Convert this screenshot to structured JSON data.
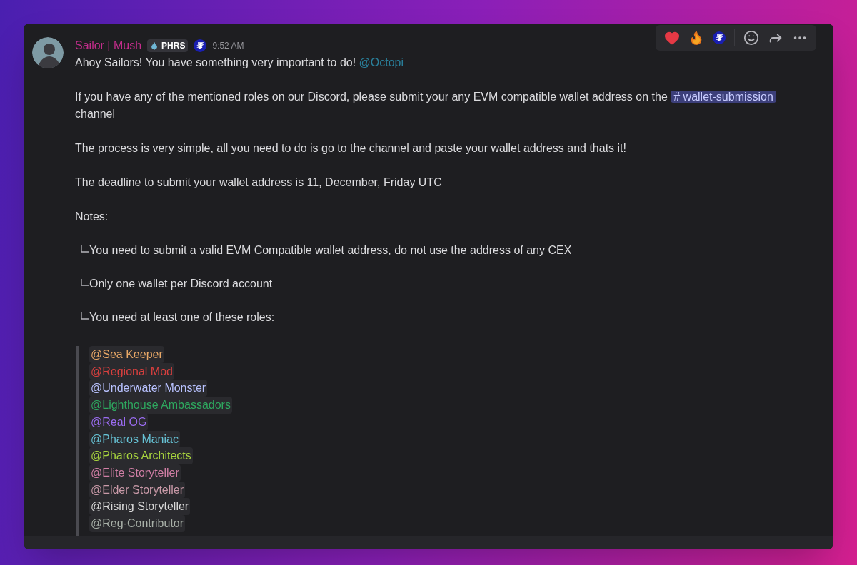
{
  "message": {
    "author": "Sailor | Mush",
    "tag": "PHRS",
    "time": "9:52 AM",
    "paragraphs": [
      {
        "kind": "text",
        "text": "Ahoy Sailors! You have something very important to do! ",
        "mention": "@Octopi"
      },
      {
        "kind": "text",
        "text": "If you have any of the mentioned roles on our Discord, please submit your any EVM compatible wallet address on the ",
        "channel": "wallet-submission",
        "channel_icon": "#",
        "after": " channel"
      },
      {
        "kind": "text",
        "text": "The process is very simple, all you need to do is go to the channel and paste your wallet address and thats it!"
      },
      {
        "kind": "text",
        "text": "The deadline to submit your wallet address is 11, December, Friday UTC"
      },
      {
        "kind": "text",
        "text": "Notes:"
      },
      {
        "kind": "bullet",
        "text": "You need to submit a valid EVM Compatible wallet address, do not use the address of any CEX"
      },
      {
        "kind": "bullet",
        "text": "Only one wallet per Discord account"
      },
      {
        "kind": "bullet",
        "text": "You need at least one of these roles:"
      }
    ],
    "roles": [
      {
        "text": "@Sea Keeper",
        "color": "#e8a867"
      },
      {
        "text": "@Regional Mod",
        "color": "#d9403f"
      },
      {
        "text": "@Underwater Monster",
        "color": "#b9c2ff"
      },
      {
        "text": "@Lighthouse Ambassadors",
        "color": "#2ea85f"
      },
      {
        "text": "@Real OG",
        "color": "#9b6cf2"
      },
      {
        "text": "@Pharos Maniac",
        "color": "#67c3d6"
      },
      {
        "text": "@Pharos Architects",
        "color": "#a8d43e"
      },
      {
        "text": "@Elite Storyteller",
        "color": "#d27fa6"
      },
      {
        "text": "@Elder Storyteller",
        "color": "#c99aa8"
      },
      {
        "text": "@Rising Storyteller",
        "color": "#d8d8d8"
      },
      {
        "text": "@Reg-Contributor",
        "color": "#a8b0a8"
      }
    ]
  }
}
